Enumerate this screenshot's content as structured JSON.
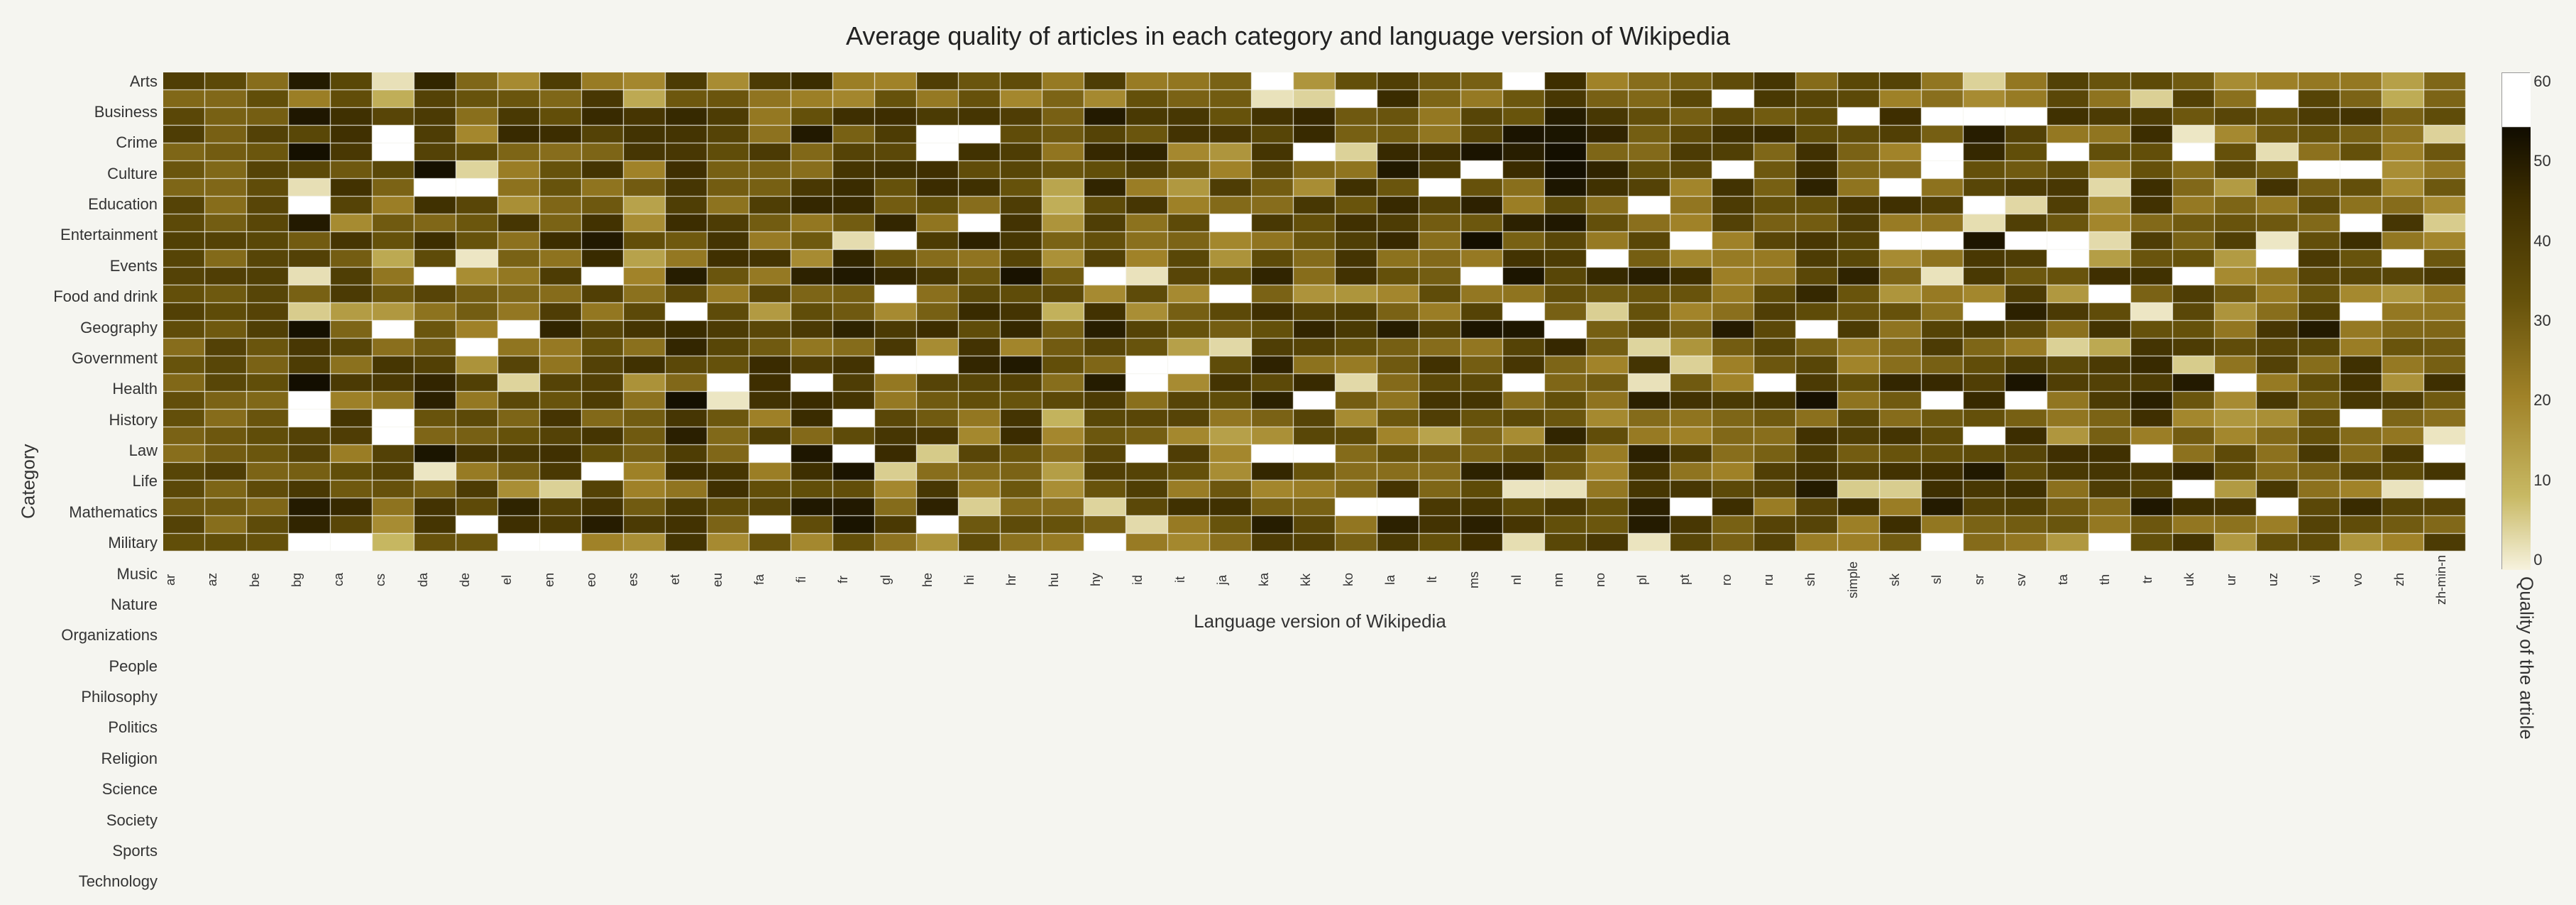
{
  "title": "Average quality of articles in each category and language version of Wikipedia",
  "xAxisTitle": "Language version of Wikipedia",
  "yAxisTitle": "Category",
  "legendTitle": "Quality of the article",
  "categories": [
    "Arts",
    "Business",
    "Crime",
    "Culture",
    "Education",
    "Entertainment",
    "Events",
    "Food and drink",
    "Geography",
    "Government",
    "Health",
    "History",
    "Law",
    "Life",
    "Mathematics",
    "Military",
    "Music",
    "Nature",
    "Organizations",
    "People",
    "Philosophy",
    "Politics",
    "Religion",
    "Science",
    "Society",
    "Sports",
    "Technology"
  ],
  "languages": [
    "ar",
    "az",
    "be",
    "bg",
    "ca",
    "cs",
    "da",
    "de",
    "el",
    "en",
    "eo",
    "es",
    "et",
    "eu",
    "fa",
    "fi",
    "fr",
    "gl",
    "he",
    "hi",
    "hr",
    "hu",
    "hy",
    "id",
    "it",
    "ja",
    "ka",
    "kk",
    "ko",
    "la",
    "lt",
    "ms",
    "nl",
    "nn",
    "no",
    "pl",
    "pt",
    "ro",
    "ru",
    "sh",
    "simple",
    "sk",
    "sl",
    "sr",
    "sv",
    "ta",
    "th",
    "tr",
    "uk",
    "ur",
    "uz",
    "vi",
    "vo",
    "zh",
    "zh-min-n"
  ],
  "legendTicks": [
    "60",
    "50",
    "40",
    "30",
    "20",
    "10",
    "0"
  ],
  "colorScale": {
    "min": 0,
    "max": 65,
    "minColor": "#f7f4e8",
    "maxColor": "#000000"
  }
}
